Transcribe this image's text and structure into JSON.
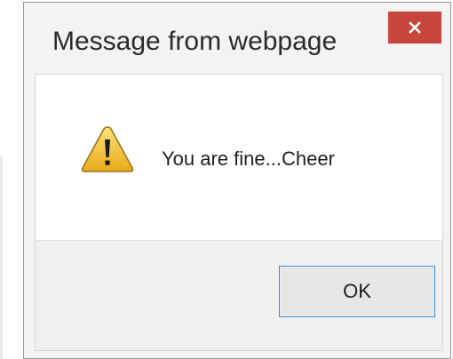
{
  "dialog": {
    "title": "Message from webpage",
    "close_icon": "close-icon",
    "message_icon": "warning-icon",
    "message": "You are fine...Cheer",
    "ok_label": "OK"
  },
  "colors": {
    "close_button": "#c7453a",
    "ok_border": "#3c8fd8",
    "warning_fill": "#f4c430"
  }
}
